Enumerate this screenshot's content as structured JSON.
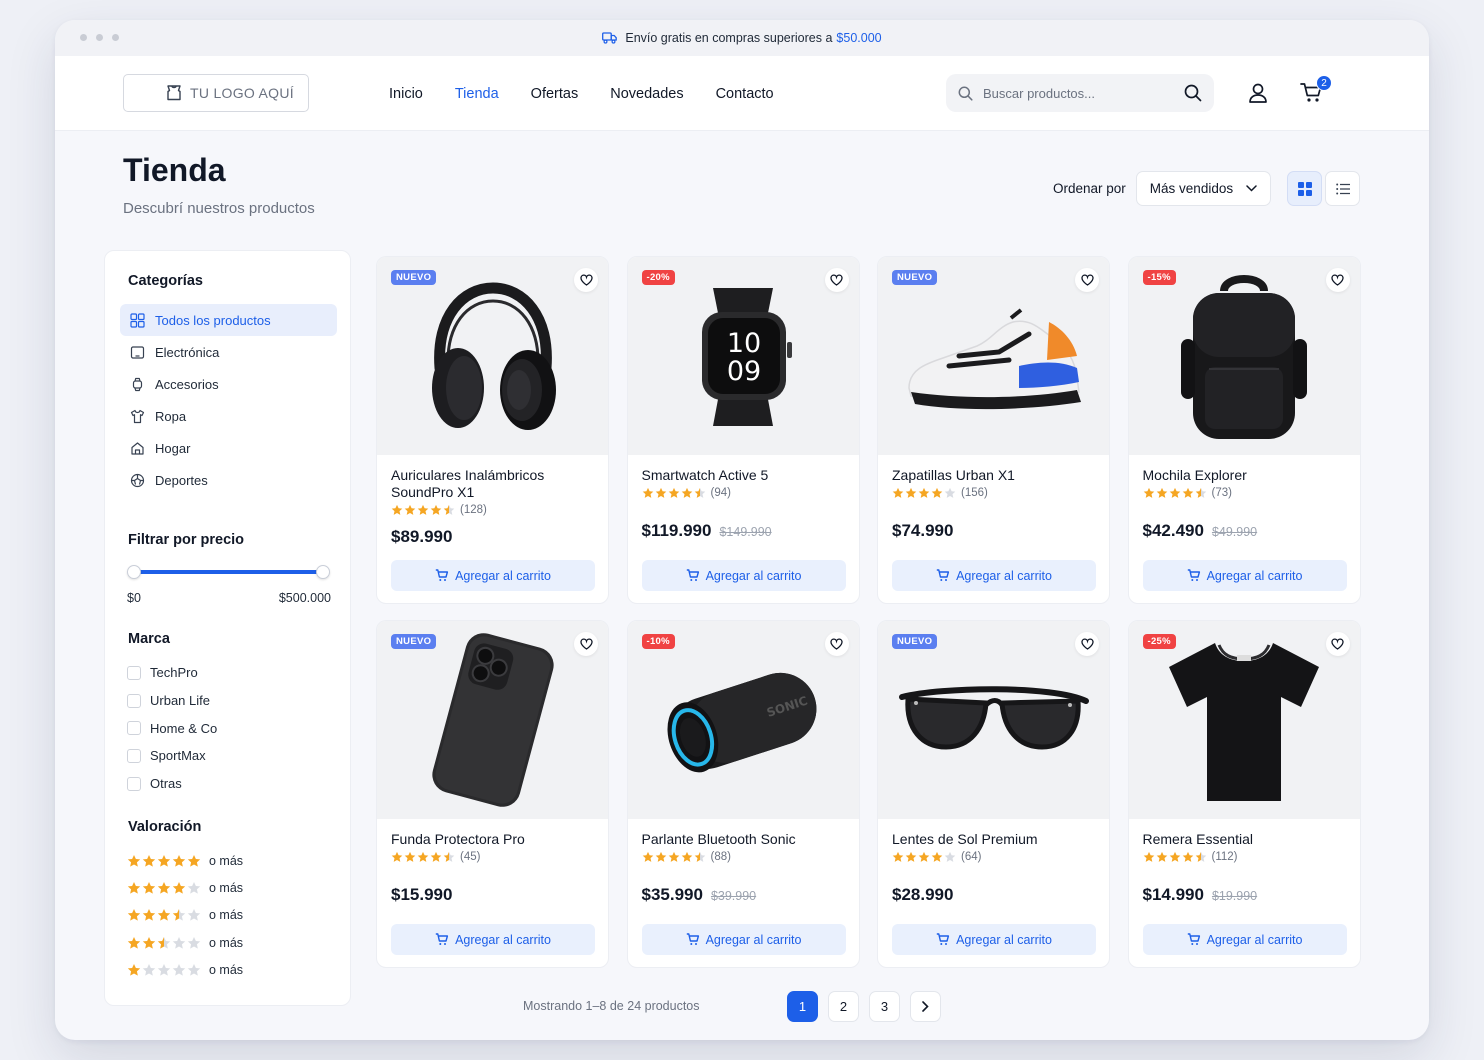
{
  "promo": {
    "text": "Envío gratis en compras superiores a",
    "amount": "$50.000"
  },
  "header": {
    "logo_text": "TU LOGO AQUÍ",
    "nav": [
      "Inicio",
      "Tienda",
      "Ofertas",
      "Novedades",
      "Contacto"
    ],
    "active_nav": "Tienda",
    "search_placeholder": "Buscar productos...",
    "cart_count": "2"
  },
  "page": {
    "title": "Tienda",
    "subtitle": "Descubrí nuestros productos"
  },
  "sort": {
    "label": "Ordenar por",
    "value": "Más vendidos"
  },
  "sidebar": {
    "categories_title": "Categorías",
    "categories": [
      {
        "label": "Todos los productos",
        "icon": "grid-icon",
        "active": true
      },
      {
        "label": "Electrónica",
        "icon": "tablet-icon"
      },
      {
        "label": "Accesorios",
        "icon": "watch-icon"
      },
      {
        "label": "Ropa",
        "icon": "shirt-icon"
      },
      {
        "label": "Hogar",
        "icon": "home-icon"
      },
      {
        "label": "Deportes",
        "icon": "ball-icon"
      }
    ],
    "price_title": "Filtrar por precio",
    "price_min": "$0",
    "price_max": "$500.000",
    "brand_title": "Marca",
    "brands": [
      "TechPro",
      "Urban Life",
      "Home & Co",
      "SportMax",
      "Otras"
    ],
    "rating_title": "Valoración",
    "rating_suffix": "o más",
    "rating_levels": [
      5,
      4,
      3.5,
      2.5,
      1
    ]
  },
  "products": [
    {
      "name": "Auriculares Inalámbricos SoundPro X1",
      "badge": "NUEVO",
      "badge_type": "new",
      "rating": 4.5,
      "reviews": "(128)",
      "price": "$89.990",
      "old_price": "",
      "image": "headphones"
    },
    {
      "name": "Smartwatch Active 5",
      "badge": "-20%",
      "badge_type": "sale",
      "rating": 4.5,
      "reviews": "(94)",
      "price": "$119.990",
      "old_price": "$149.990",
      "image": "smartwatch"
    },
    {
      "name": "Zapatillas Urban X1",
      "badge": "NUEVO",
      "badge_type": "new",
      "rating": 4,
      "reviews": "(156)",
      "price": "$74.990",
      "old_price": "",
      "image": "sneaker"
    },
    {
      "name": "Mochila Explorer",
      "badge": "-15%",
      "badge_type": "sale",
      "rating": 4.5,
      "reviews": "(73)",
      "price": "$42.490",
      "old_price": "$49.990",
      "image": "backpack"
    },
    {
      "name": "Funda Protectora Pro",
      "badge": "NUEVO",
      "badge_type": "new",
      "rating": 4.5,
      "reviews": "(45)",
      "price": "$15.990",
      "old_price": "",
      "image": "phone-case"
    },
    {
      "name": "Parlante Bluetooth Sonic",
      "badge": "-10%",
      "badge_type": "sale",
      "rating": 4.5,
      "reviews": "(88)",
      "price": "$35.990",
      "old_price": "$39.990",
      "image": "speaker"
    },
    {
      "name": "Lentes de Sol Premium",
      "badge": "NUEVO",
      "badge_type": "new",
      "rating": 4,
      "reviews": "(64)",
      "price": "$28.990",
      "old_price": "",
      "image": "sunglasses"
    },
    {
      "name": "Remera Essential",
      "badge": "-25%",
      "badge_type": "sale",
      "rating": 4.5,
      "reviews": "(112)",
      "price": "$14.990",
      "old_price": "$19.990",
      "image": "tshirt"
    }
  ],
  "add_to_cart": "Agregar al carrito",
  "pagination": {
    "info": "Mostrando 1–8 de 24 productos",
    "pages": [
      "1",
      "2",
      "3"
    ],
    "current": "1"
  },
  "colors": {
    "accent": "#1d5fe8",
    "sale": "#f04343",
    "new": "#5b7ff0",
    "star": "#f5a623"
  }
}
